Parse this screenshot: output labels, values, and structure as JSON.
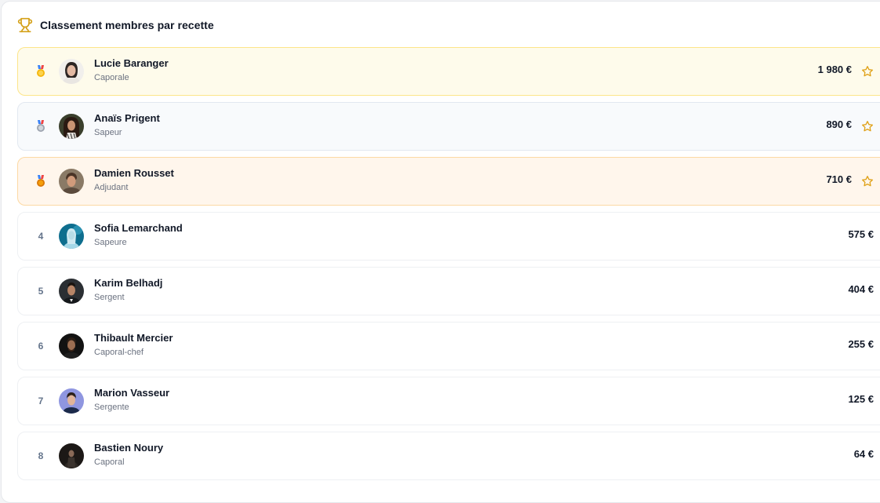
{
  "header": {
    "title": "Classement membres par recette",
    "icon": "trophy-icon",
    "accent": "#d4a017"
  },
  "members": [
    {
      "rank": "1",
      "medal": "gold-medal-icon",
      "name": "Lucie Baranger",
      "role": "Caporale",
      "amount": "1 980 €",
      "starred": true
    },
    {
      "rank": "2",
      "medal": "silver-medal-icon",
      "name": "Anaïs Prigent",
      "role": "Sapeur",
      "amount": "890 €",
      "starred": true
    },
    {
      "rank": "3",
      "medal": "bronze-medal-icon",
      "name": "Damien Rousset",
      "role": "Adjudant",
      "amount": "710 €",
      "starred": true
    },
    {
      "rank": "4",
      "name": "Sofia Lemarchand",
      "role": "Sapeure",
      "amount": "575 €",
      "starred": false
    },
    {
      "rank": "5",
      "name": "Karim Belhadj",
      "role": "Sergent",
      "amount": "404 €",
      "starred": false
    },
    {
      "rank": "6",
      "name": "Thibault Mercier",
      "role": "Caporal-chef",
      "amount": "255 €",
      "starred": false
    },
    {
      "rank": "7",
      "name": "Marion Vasseur",
      "role": "Sergente",
      "amount": "125 €",
      "starred": false
    },
    {
      "rank": "8",
      "name": "Bastien Noury",
      "role": "Caporal",
      "amount": "64 €",
      "starred": false
    }
  ],
  "colors": {
    "gold_row_bg": "#fefbeb",
    "silver_row_bg": "#f8fafc",
    "bronze_row_bg": "#fff6ec",
    "star": "#e0a21a"
  }
}
